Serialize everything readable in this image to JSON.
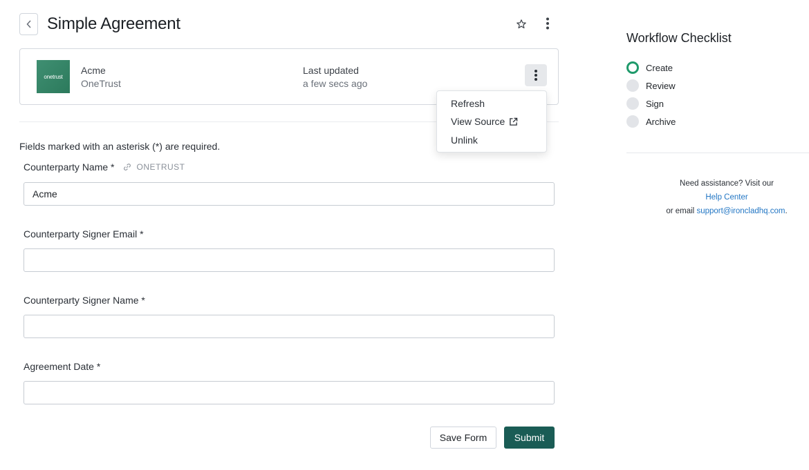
{
  "header": {
    "title": "Simple Agreement",
    "back_icon": "chevron-left-icon",
    "star_icon": "star-outline-icon",
    "more_icon": "vertical-ellipsis-icon"
  },
  "record_card": {
    "logo_text": "onetrust",
    "name": "Acme",
    "source": "OneTrust",
    "updated_label": "Last updated",
    "updated_value": "a few secs ago"
  },
  "menu": {
    "items": [
      {
        "label": "Refresh"
      },
      {
        "label": "View Source",
        "icon": "external-link-icon"
      },
      {
        "label": "Unlink"
      }
    ]
  },
  "form": {
    "required_note": "Fields marked with an asterisk (*) are required.",
    "fields": [
      {
        "label": "Counterparty Name *",
        "value": "Acme",
        "link_tag": "ONETRUST"
      },
      {
        "label": "Counterparty Signer Email *",
        "value": ""
      },
      {
        "label": "Counterparty Signer Name *",
        "value": ""
      },
      {
        "label": "Agreement Date *",
        "value": ""
      }
    ],
    "save_label": "Save Form",
    "submit_label": "Submit"
  },
  "workflow": {
    "title": "Workflow Checklist",
    "steps": [
      {
        "label": "Create",
        "active": true
      },
      {
        "label": "Review",
        "active": false
      },
      {
        "label": "Sign",
        "active": false
      },
      {
        "label": "Archive",
        "active": false
      }
    ]
  },
  "help": {
    "line1": "Need assistance? Visit our",
    "link": "Help Center",
    "line3_prefix": "or email",
    "email": "support@ironcladhq.com",
    "line3_suffix": "."
  },
  "colors": {
    "accent": "#1a5c55",
    "active_step": "#1f9a6b",
    "link": "#2276c4"
  }
}
